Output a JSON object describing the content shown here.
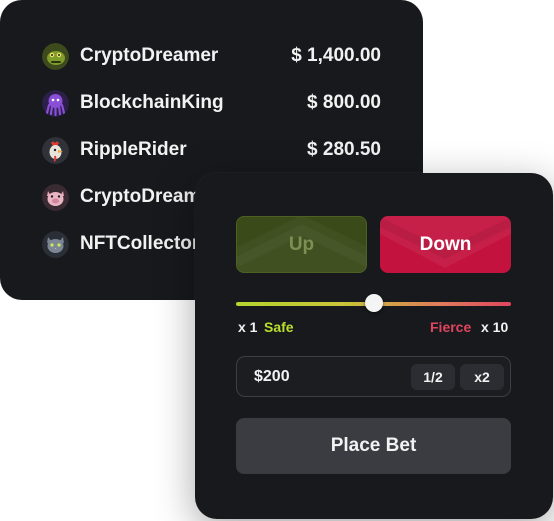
{
  "leaderboard": {
    "rows": [
      {
        "name": "CryptoDreamer",
        "amount": "$ 1,400.00",
        "avatar_icon": "dinosaur-avatar-icon"
      },
      {
        "name": "BlockchainKing",
        "amount": "$ 800.00",
        "avatar_icon": "octopus-avatar-icon"
      },
      {
        "name": "RippleRider",
        "amount": "$ 280.50",
        "avatar_icon": "rooster-avatar-icon"
      },
      {
        "name": "CryptoDream",
        "amount": "",
        "avatar_icon": "pig-avatar-icon"
      },
      {
        "name": "NFTCollector",
        "amount": "",
        "avatar_icon": "cat-avatar-icon"
      }
    ]
  },
  "bet": {
    "up_label": "Up",
    "down_label": "Down",
    "risk_level": 0.5,
    "risk_min": "x 1",
    "risk_min_label": "Safe",
    "risk_max_label": "Fierce",
    "risk_max": "x 10",
    "amount": "$200",
    "half_label": "1/2",
    "double_label": "x2",
    "place_label": "Place Bet"
  },
  "colors": {
    "background": "#18191c",
    "up": "#3a4a18",
    "down": "#c3123d",
    "safe": "#b9df2e",
    "fierce": "#e0455f"
  }
}
